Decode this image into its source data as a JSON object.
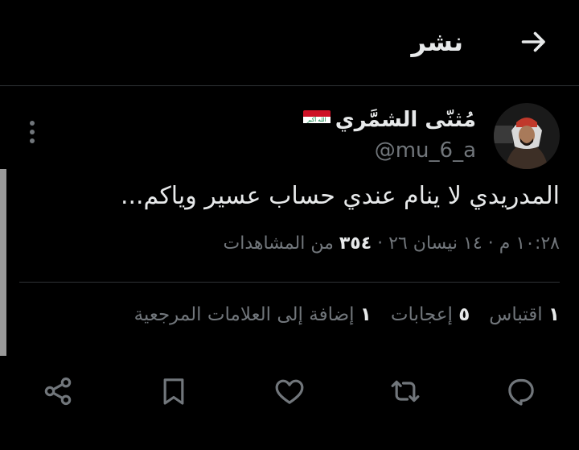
{
  "header": {
    "title": "نشر"
  },
  "author": {
    "display_name": "مُثنّى الشمَّري",
    "handle": "@mu_6_a",
    "flag_text": "الله أكبر"
  },
  "tweet": {
    "text": "المدريدي لا ينام عندي حساب عسير وياكم...",
    "time": "١٠:٢٨ م",
    "separator": "·",
    "date": "١٤ نيسان ٢٦",
    "views_count": "٣٥٤",
    "views_label": "من المشاهدات"
  },
  "stats": [
    {
      "count": "١",
      "label": "اقتباس"
    },
    {
      "count": "٥",
      "label": "إعجابات"
    },
    {
      "count": "١",
      "label": "إضافة إلى العلامات المرجعية"
    }
  ],
  "colors": {
    "background": "#000000",
    "text": "#e7e9ea",
    "muted": "#71767b",
    "divider": "#2f3336"
  },
  "actions": [
    "reply-icon",
    "retweet-icon",
    "like-icon",
    "bookmark-icon",
    "share-icon"
  ]
}
